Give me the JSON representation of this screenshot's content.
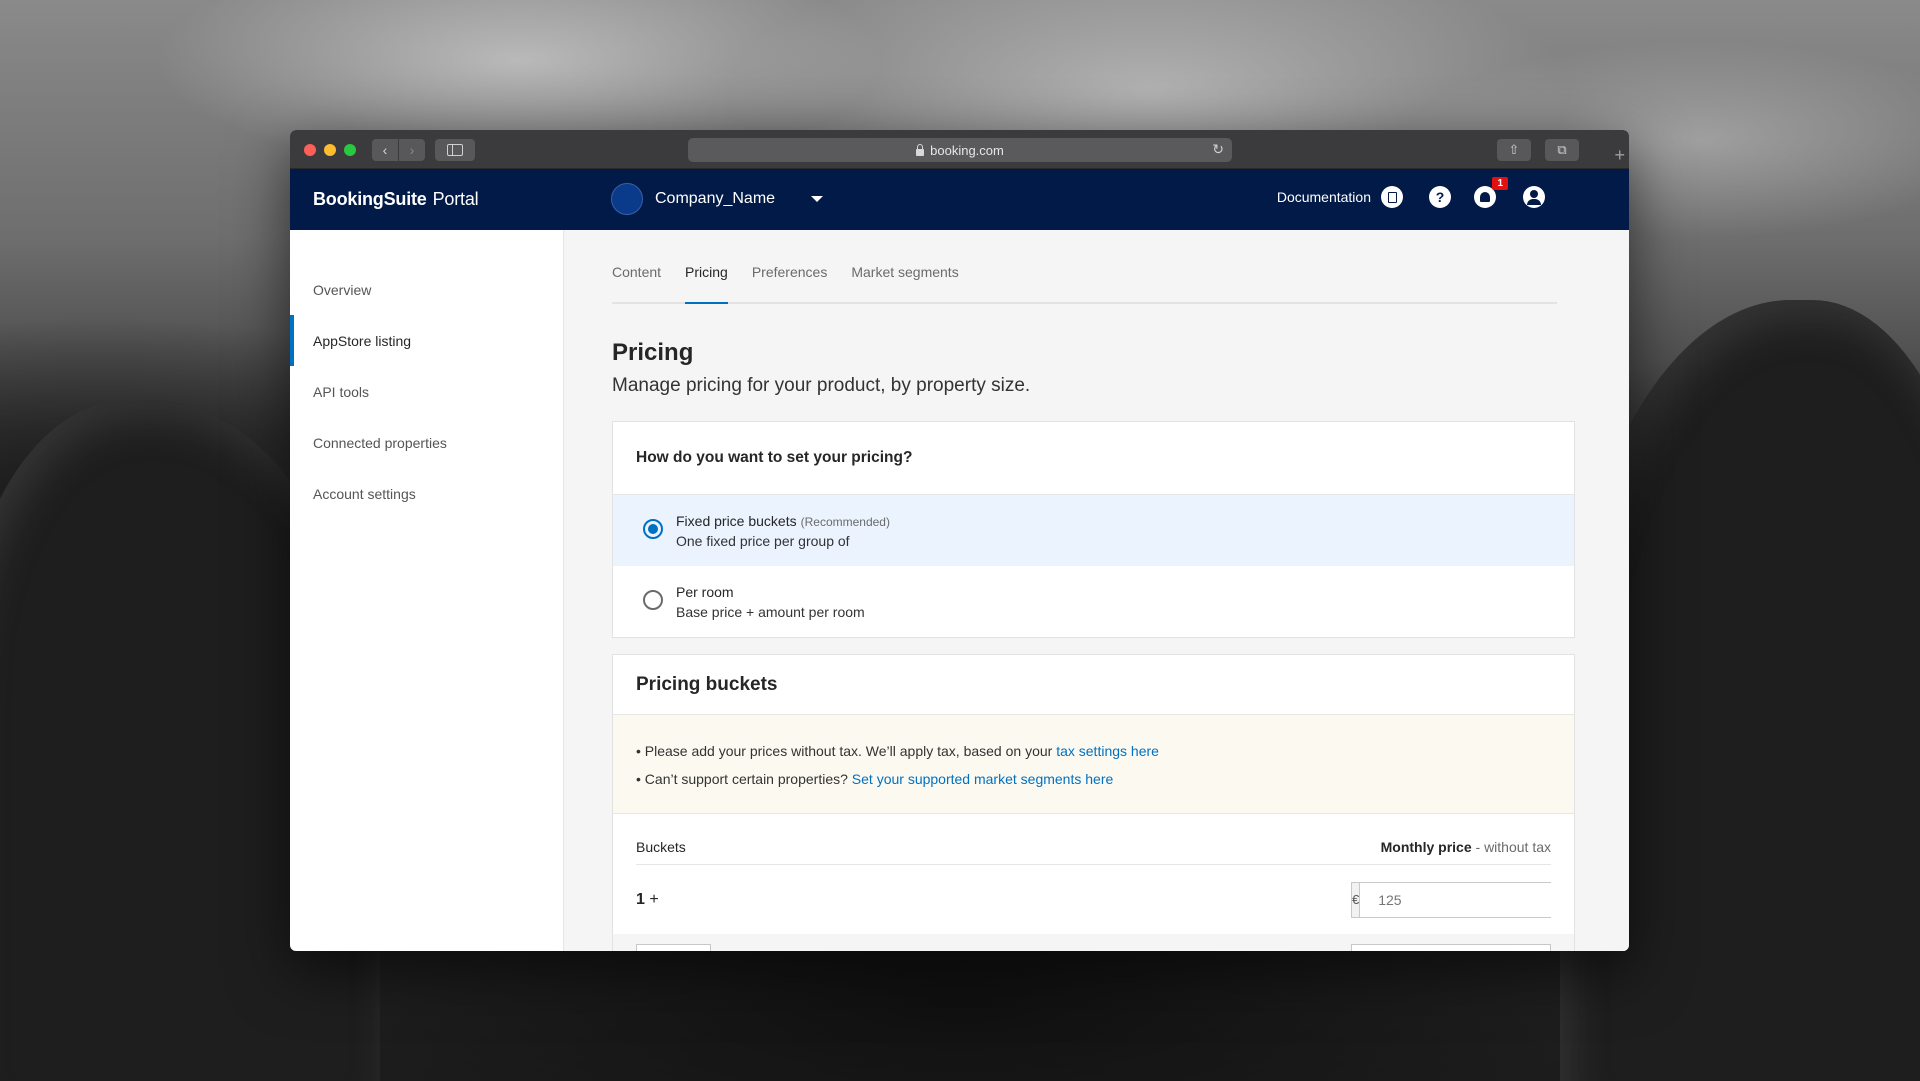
{
  "browser": {
    "url": "booking.com"
  },
  "app": {
    "brand": "BookingSuite",
    "brand_suffix": "Portal",
    "company_name": "Company_Name",
    "documentation_label": "Documentation",
    "notification_count": "1"
  },
  "sidebar": {
    "items": [
      {
        "label": "Overview",
        "active": false
      },
      {
        "label": "AppStore listing",
        "active": true
      },
      {
        "label": "API tools",
        "active": false
      },
      {
        "label": "Connected properties",
        "active": false
      },
      {
        "label": "Account settings",
        "active": false
      }
    ]
  },
  "tabs": [
    {
      "label": "Content",
      "active": false
    },
    {
      "label": "Pricing",
      "active": true
    },
    {
      "label": "Preferences",
      "active": false
    },
    {
      "label": "Market segments",
      "active": false
    }
  ],
  "page": {
    "title": "Pricing",
    "subtitle": "Manage pricing for your product, by property size."
  },
  "pricing_method": {
    "question": "How do you want to set your pricing?",
    "options": [
      {
        "title": "Fixed price buckets",
        "tag": "(Recommended)",
        "description": "One fixed price per group of",
        "selected": true
      },
      {
        "title": "Per room",
        "tag": "",
        "description": "Base price + amount per room",
        "selected": false
      }
    ]
  },
  "buckets": {
    "title": "Pricing buckets",
    "notice_1_text": "• Please add your prices without tax. We’ll apply tax, based on your ",
    "notice_1_link": "tax settings here",
    "notice_2_text": "• Can’t support certain properties? ",
    "notice_2_link": "Set your supported market segments here",
    "col_buckets": "Buckets",
    "col_price": "Monthly price",
    "col_price_note": " - without tax",
    "rows": [
      {
        "min": "1",
        "suffix": "+",
        "currency": "€",
        "price_placeholder": "125"
      }
    ]
  }
}
